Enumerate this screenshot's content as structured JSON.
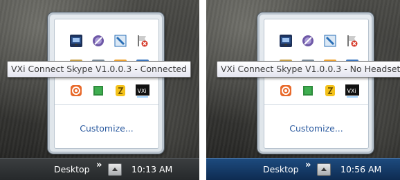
{
  "panels": [
    {
      "tooltip": "VXi Connect Skype V1.0.0.3 - Connected",
      "customize_label": "Customize...",
      "taskbar": {
        "desktop_label": "Desktop",
        "chevron": "»",
        "clock": "10:13 AM"
      }
    },
    {
      "tooltip": "VXi Connect Skype V1.0.0.3 - No Headset",
      "customize_label": "Customize...",
      "taskbar": {
        "desktop_label": "Desktop",
        "chevron": "»",
        "clock": "10:56 AM"
      }
    }
  ],
  "tray_icons": [
    {
      "row": 1,
      "name": "network-monitor-icon",
      "color": "#2a4f88"
    },
    {
      "row": 1,
      "name": "disc-utility-icon",
      "color": "#6e58a6"
    },
    {
      "row": 1,
      "name": "tool-window-icon",
      "color": "#2a6fb7"
    },
    {
      "row": 1,
      "name": "flag-error-icon",
      "color": "#d63b2b"
    },
    {
      "row": 2,
      "name": "folder-icon",
      "color": "#c8a24a"
    },
    {
      "row": 2,
      "name": "arrow-icon",
      "color": "#7a8b99"
    },
    {
      "row": 2,
      "name": "orange-app-icon",
      "color": "#f0a431"
    },
    {
      "row": 2,
      "name": "blue-app-icon",
      "color": "#3d78c0"
    },
    {
      "row": 3,
      "name": "swirl-app-icon",
      "color": "#e8692a"
    },
    {
      "row": 3,
      "name": "green-square-icon",
      "color": "#2e8b3c"
    },
    {
      "row": 3,
      "name": "yellow-app-icon",
      "color": "#f4c21b"
    },
    {
      "row": 3,
      "name": "vxi-headset-icon",
      "color": "#111111"
    }
  ]
}
